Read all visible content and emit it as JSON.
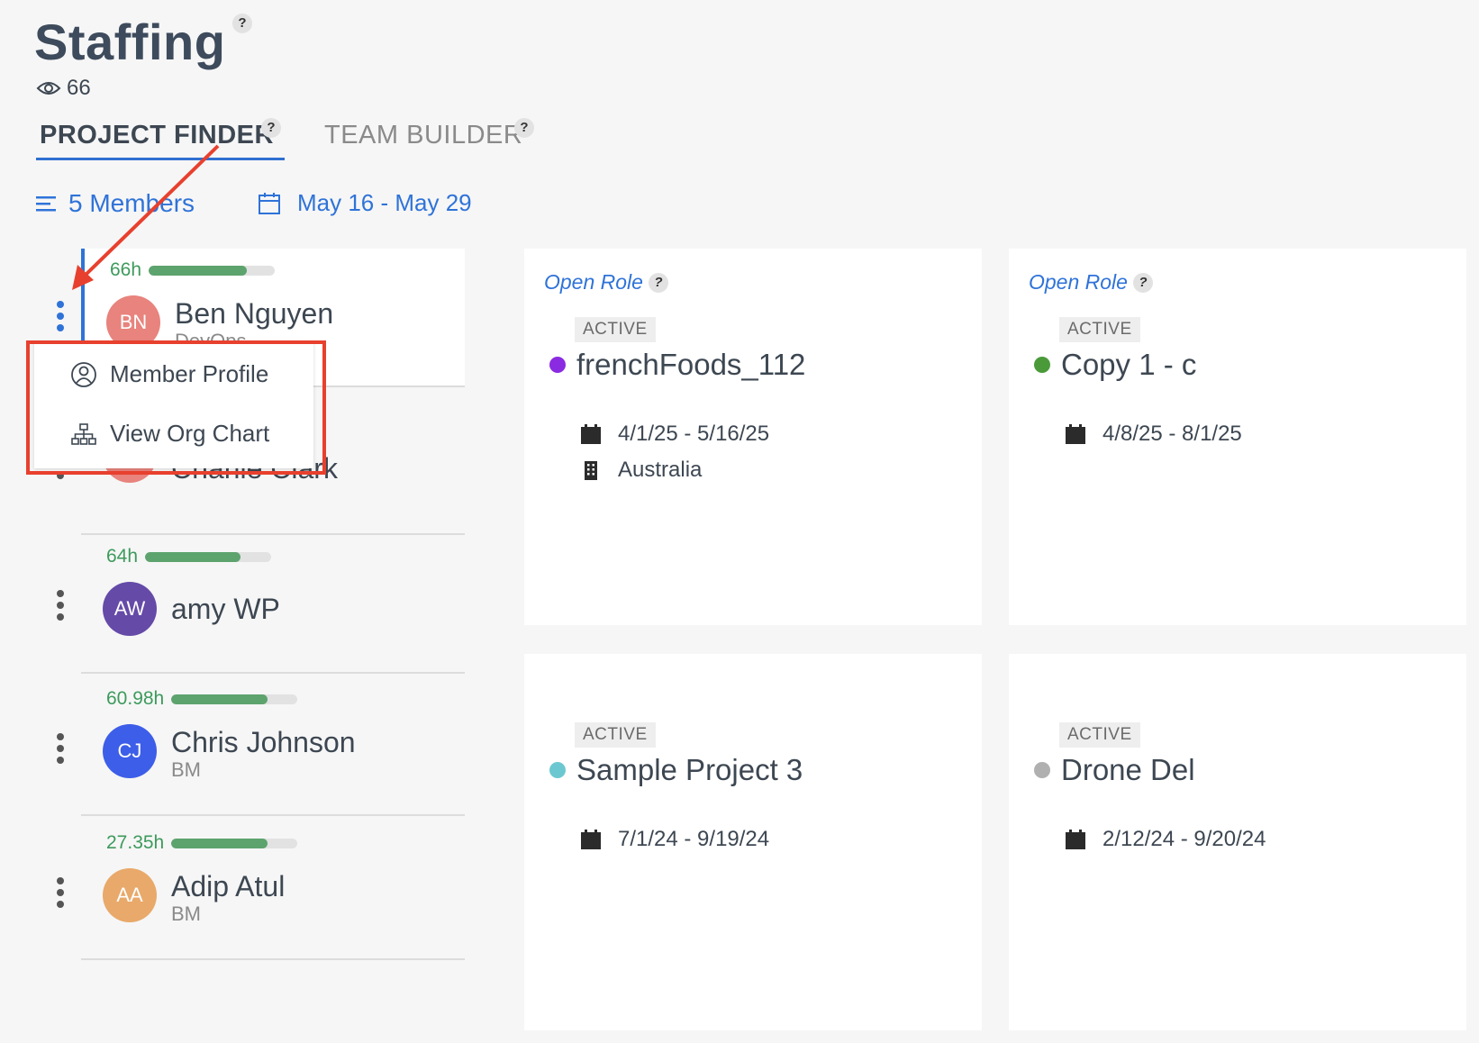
{
  "page": {
    "title": "Staffing",
    "views": "66"
  },
  "help_label": "?",
  "tabs": [
    {
      "label": "PROJECT FINDER",
      "active": true
    },
    {
      "label": "TEAM BUILDER",
      "active": false
    }
  ],
  "filters": {
    "members_label": "5 Members",
    "date_range": "May 16 - May 29"
  },
  "members": [
    {
      "hours": "66h",
      "utilization": 0.78,
      "initials": "BN",
      "name": "Ben Nguyen",
      "role": "DevOps",
      "avatar_color": "#e8837d"
    },
    {
      "hours": "",
      "utilization": 0,
      "initials": "CC",
      "name": "Charlie Clark",
      "role": "",
      "avatar_color": "#e8837d"
    },
    {
      "hours": "64h",
      "utilization": 0.76,
      "initials": "AW",
      "name": "amy WP",
      "role": "",
      "avatar_color": "#654aa8"
    },
    {
      "hours": "60.98h",
      "utilization": 0.76,
      "initials": "CJ",
      "name": "Chris Johnson",
      "role": "BM",
      "avatar_color": "#3d5ee8"
    },
    {
      "hours": "27.35h",
      "utilization": 0.76,
      "initials": "AA",
      "name": "Adip Atul",
      "role": "BM",
      "avatar_color": "#e8a96a"
    }
  ],
  "context_menu": {
    "items": [
      {
        "label": "Member Profile",
        "icon": "user-circle-icon"
      },
      {
        "label": "View Org Chart",
        "icon": "org-chart-icon"
      }
    ]
  },
  "projects": [
    {
      "open_role": "Open Role",
      "status": "ACTIVE",
      "name": "frenchFoods_112",
      "dot_color": "#8a2be2",
      "dates": "4/1/25 - 5/16/25",
      "location": "Australia"
    },
    {
      "open_role": "Open Role",
      "status": "ACTIVE",
      "name": "Copy 1 - c",
      "dot_color": "#4a9a3a",
      "dates": "4/8/25 - 8/1/25",
      "location": ""
    },
    {
      "open_role": "",
      "status": "ACTIVE",
      "name": "Sample Project 3",
      "dot_color": "#6cc8d0",
      "dates": "7/1/24 - 9/19/24",
      "location": ""
    },
    {
      "open_role": "",
      "status": "ACTIVE",
      "name": "Drone Del",
      "dot_color": "#b0b0b0",
      "dates": "2/12/24 - 9/20/24",
      "location": ""
    }
  ],
  "colors": {
    "accent": "#2f73d8",
    "hours_green": "#3d9a5c",
    "annotation_red": "#e8402e"
  }
}
